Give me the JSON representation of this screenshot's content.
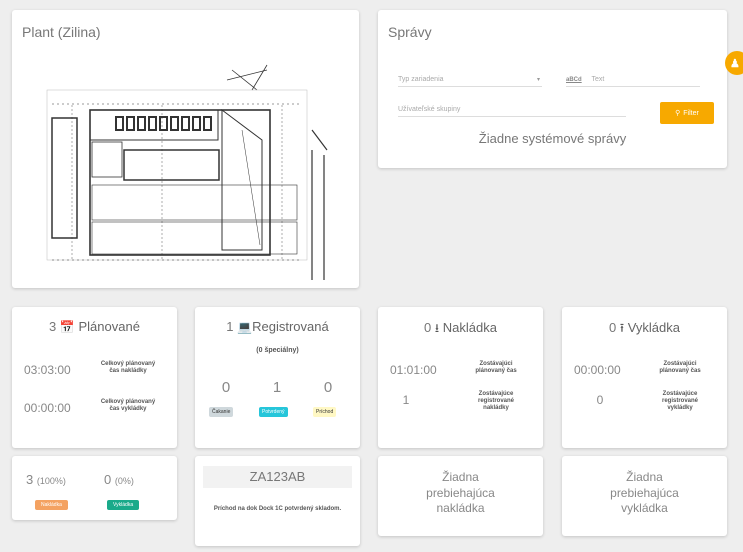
{
  "plant": {
    "title": "Plant (Zilina)"
  },
  "messages": {
    "title": "Správy",
    "device_type_placeholder": "Typ zariadenia",
    "text_prefix": "aBCd",
    "text_placeholder": "Text",
    "user_group_placeholder": "Užívateľské skupiny",
    "filter_label": "Filter",
    "empty_text": "Žiadne systémové správy"
  },
  "planned": {
    "count": "3",
    "label": "Plánované",
    "loading_time": "03:03:00",
    "loading_label": "Celkový plánovaný čas nakládky",
    "unloading_time": "00:00:00",
    "unloading_label": "Celkový plánovaný čas vykládky"
  },
  "registered": {
    "count": "1",
    "label": "Registrovaná",
    "special": "(0 špeciálny)",
    "statuses": [
      {
        "count": "0",
        "label": "Čakanie",
        "color": "#cfd8dc"
      },
      {
        "count": "1",
        "label": "Potvrdený",
        "color": "#26c6da"
      },
      {
        "count": "0",
        "label": "Príchod",
        "color": "#fff8c4"
      }
    ]
  },
  "loading": {
    "count": "0",
    "label": "Nakládka",
    "time": "01:01:00",
    "time_label": "Zostávajúci plánovaný čas",
    "registered_count": "1",
    "registered_label": "Zostávajúce registrované nakládky"
  },
  "unloading": {
    "count": "0",
    "label": "Vykládka",
    "time": "00:00:00",
    "time_label": "Zostávajúci plánovaný čas",
    "registered_count": "0",
    "registered_label": "Zostávajúce registrované vykládky"
  },
  "share": {
    "loading_count": "3",
    "loading_pct": "(100%)",
    "loading_label": "Nakládka",
    "loading_color": "#f4a261",
    "unloading_count": "0",
    "unloading_pct": "(0%)",
    "unloading_label": "Vykládka",
    "unloading_color": "#1aaa8a"
  },
  "plate": {
    "number": "ZA123AB",
    "message": "Príchod na dok Dock 1C potvrdený skladom."
  },
  "no_loading": {
    "text": "Žiadna prebiehajúca nakládka"
  },
  "no_unloading": {
    "text": "Žiadna prebiehajúca vykládka"
  },
  "colors": {
    "accent": "#f7a900"
  },
  "icons": {
    "planned": "calendar-icon",
    "registered": "laptop-icon",
    "loading": "download-icon",
    "unloading": "upload-icon",
    "filter": "search-icon",
    "fab": "person-icon"
  }
}
